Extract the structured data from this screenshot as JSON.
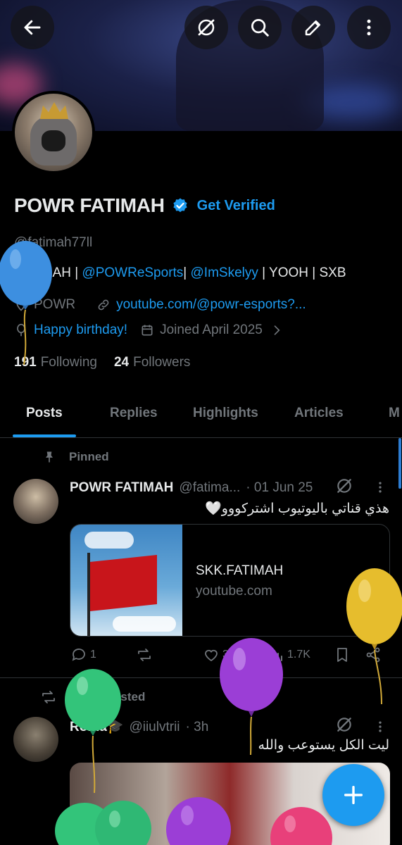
{
  "profile": {
    "display_name": "POWR FATIMAH",
    "get_verified": "Get Verified",
    "handle": "@fatimah77ll",
    "bio": {
      "part1": "FATIMAH | ",
      "link1": "@POWReSports",
      "part2": "| ",
      "link2": "@ImSkelyy",
      "part3": " | YOOH | SXB"
    },
    "location": "POWR",
    "website": "youtube.com/@powr-esports?...",
    "birthday": "Happy birthday!",
    "joined": "Joined April 2025",
    "following_count": "191",
    "following_label": "Following",
    "followers_count": "24",
    "followers_label": "Followers"
  },
  "tabs": [
    {
      "label": "Posts",
      "active": true
    },
    {
      "label": "Replies"
    },
    {
      "label": "Highlights"
    },
    {
      "label": "Articles"
    },
    {
      "label": "M"
    }
  ],
  "posts": [
    {
      "context": "Pinned",
      "name": "POWR FATIMAH",
      "handle": "@fatima...",
      "time": "· 01 Jun 25",
      "text": "هذي قناتي باليوتيوب اشتركووو🤍",
      "card": {
        "title": "SKK.FATIMAH",
        "domain": "youtube.com"
      },
      "reply_count": "1",
      "like_count": "3",
      "view_count": "1.7K"
    },
    {
      "context": "You reposted",
      "name": "Roma🎓",
      "handle": "@iiulvtrii",
      "time": "· 3h",
      "text": "ليت الكل يستوعب والله"
    }
  ],
  "icons": {
    "back": "back-arrow-icon",
    "grok": "grok-icon",
    "search": "search-icon",
    "edit": "edit-icon",
    "more": "more-vertical-icon",
    "fab": "plus-icon"
  },
  "colors": {
    "accent": "#1d9bf0",
    "background": "#000000",
    "text_primary": "#e7e9ea",
    "text_secondary": "#71767b",
    "balloon_blue": "#3d8fe0",
    "balloon_yellow": "#e6bd2d",
    "balloon_purple": "#9b3ed6",
    "balloon_green": "#33c47a",
    "balloon_pink": "#e8407a"
  }
}
